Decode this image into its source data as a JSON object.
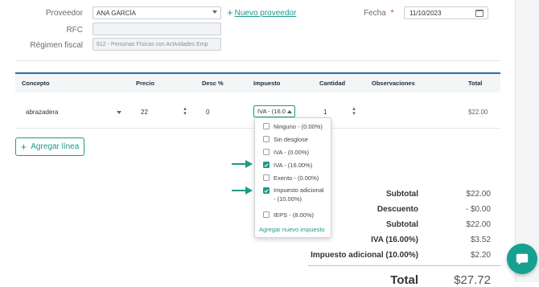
{
  "form": {
    "proveedor_label": "Proveedor",
    "proveedor_value": "ANA GARCÍA",
    "nuevo_proveedor": "Nuevo proveedor",
    "fecha_label": "Fecha",
    "fecha_required": "*",
    "fecha_value": "11/10/2023",
    "rfc_label": "RFC",
    "rfc_value": "",
    "regimen_label": "Régimen fiscal",
    "regimen_value": "612 - Personas Físicas con Actividades Emp"
  },
  "table": {
    "headers": [
      "Concepto",
      "Precio",
      "Desc %",
      "Impuesto",
      "Cantidad",
      "Observaciones",
      "Total"
    ],
    "row": {
      "concepto": "abrazadera",
      "precio": "22",
      "desc": "0",
      "impuesto": "IVA - (16.0",
      "cantidad": "1",
      "observaciones": "",
      "total": "$22.00"
    },
    "add_line": "Agregar línea"
  },
  "tax_dropdown": {
    "options": [
      {
        "label": "Ninguno - (0.00%)",
        "checked": false
      },
      {
        "label": "Sin desglose",
        "checked": false
      },
      {
        "label": "IVA - (0.00%)",
        "checked": false
      },
      {
        "label": "IVA - (16.00%)",
        "checked": true
      },
      {
        "label": "Exento - (0.00%)",
        "checked": false
      },
      {
        "label": "Impuesto adicional",
        "label2": "- (10.00%)",
        "checked": true
      },
      {
        "label": "IEPS - (8.00%)",
        "checked": false
      }
    ],
    "add_new": "Agregar nuevo impuesto"
  },
  "totals": [
    {
      "label": "Subtotal",
      "value": "$22.00"
    },
    {
      "label": "Descuento",
      "value": "- $0.00"
    },
    {
      "label": "Subtotal",
      "value": "$22.00"
    },
    {
      "label": "IVA (16.00%)",
      "value": "$3.52"
    },
    {
      "label": "Impuesto adicional (10.00%)",
      "value": "$2.20"
    },
    {
      "label": "Total",
      "value": "$27.72"
    }
  ],
  "colors": {
    "accent": "#1c9a8a",
    "header_rule": "#2e6db0",
    "chat_button": "#15a08f"
  },
  "icons": [
    "chevron-down-icon",
    "plus-icon",
    "calendar-icon",
    "spinner-icon",
    "check-icon",
    "arrow-right-icon",
    "chat-icon"
  ]
}
